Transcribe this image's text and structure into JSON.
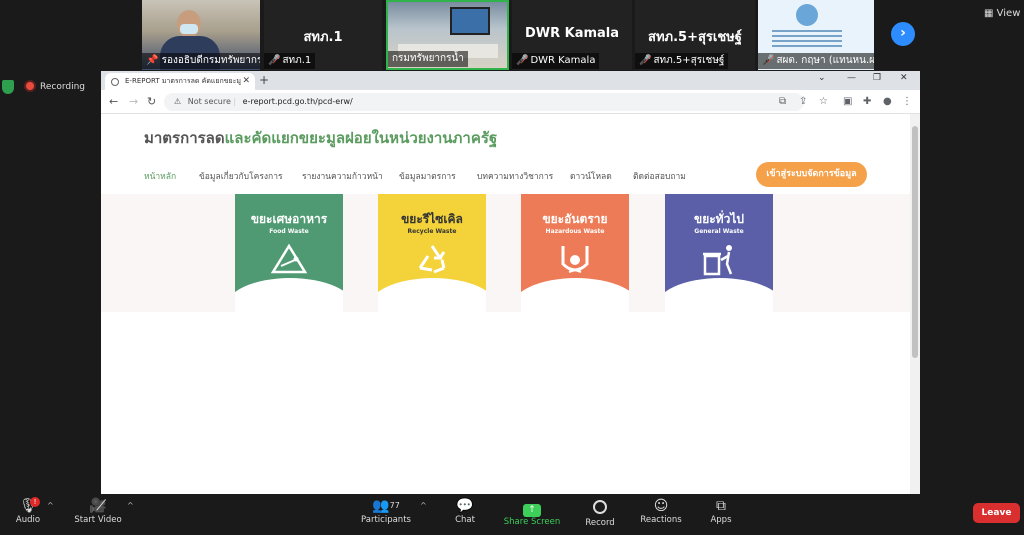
{
  "participants": [
    {
      "name": "รองอธิบดีกรมทรัพยากรน้ำ",
      "label": ""
    },
    {
      "name": "สทภ.1",
      "label": "สทภ.1"
    },
    {
      "name": "กรมทรัพยากรน้ำ",
      "label": ""
    },
    {
      "name": "DWR Kamala",
      "label": "DWR Kamala"
    },
    {
      "name": "สทภ.5+สุรเชษฐ์",
      "label": "สทภ.5+สุรเชษฐ์"
    },
    {
      "name": "สผต. กฤษา (แทนหน.ผต.)",
      "label": ""
    }
  ],
  "view_label": "View",
  "recording_label": "Recording",
  "browser": {
    "tab_title": "E-REPORT มาตรการลด คัดแยกขยะมู",
    "address_warning": "Not secure",
    "url": "e-report.pcd.go.th/pcd-erw/"
  },
  "site": {
    "title_part1": "มาตรการลด",
    "title_part2": "และคัดแยกขยะมูลฝอยในหน่วยงานภาครัฐ",
    "nav": [
      "หน้าหลัก",
      "ข้อมูลเกี่ยวกับโครงการ",
      "รายงานความก้าวหน้า",
      "ข้อมูลมาตรการ",
      "บทความทางวิชาการ",
      "ดาวน์โหลด",
      "ติดต่อสอบถาม"
    ],
    "cta": "เข้าสู่ระบบจัดการข้อมูล",
    "cards": [
      {
        "title": "ขยะเศษอาหาร",
        "subtitle": "Food Waste",
        "color": "#4f9a72",
        "icon": "food-waste-icon"
      },
      {
        "title": "ขยะรีไซเคิล",
        "subtitle": "Recycle Waste",
        "color": "#f3d23a",
        "icon": "recycle-icon"
      },
      {
        "title": "ขยะอันตราย",
        "subtitle": "Hazardous Waste",
        "color": "#ee7b57",
        "icon": "hazard-icon"
      },
      {
        "title": "ขยะทั่วไป",
        "subtitle": "General Waste",
        "color": "#5a5fa8",
        "icon": "trash-bin-icon"
      }
    ]
  },
  "toolbar": {
    "audio": "Audio",
    "audio_badge": "!",
    "start_video": "Start Video",
    "participants": "Participants",
    "participant_count": "77",
    "chat": "Chat",
    "share_screen": "Share Screen",
    "record": "Record",
    "reactions": "Reactions",
    "apps": "Apps",
    "leave": "Leave"
  }
}
